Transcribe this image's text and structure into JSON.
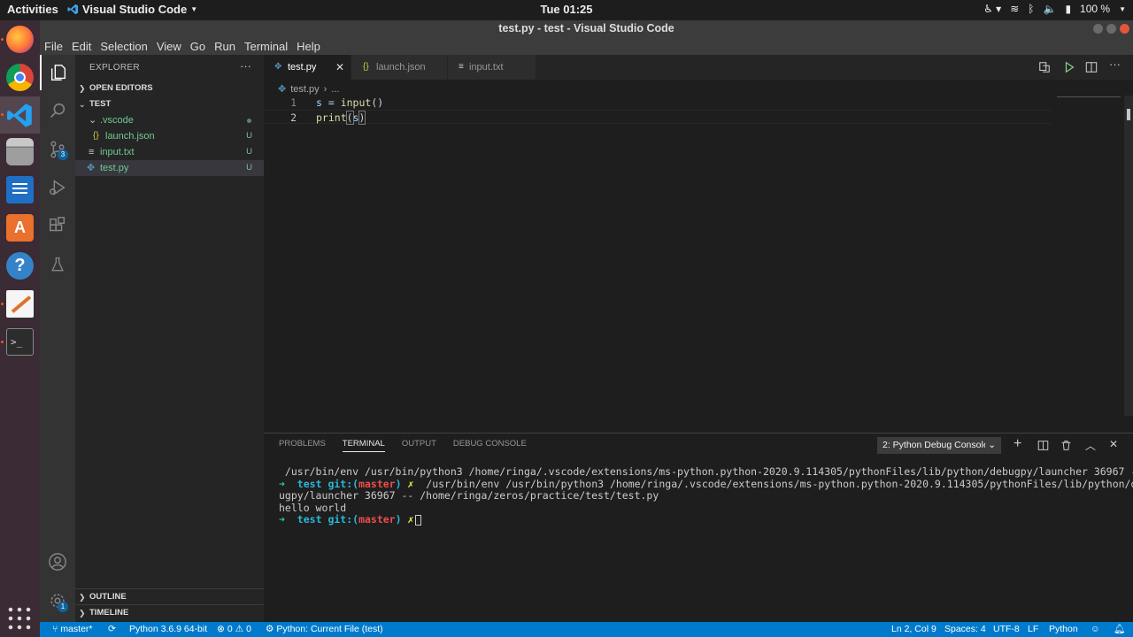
{
  "system": {
    "activities": "Activities",
    "app_name": "Visual Studio Code",
    "clock": "Tue 01:25",
    "battery": "100 %"
  },
  "window": {
    "title": "test.py - test - Visual Studio Code"
  },
  "menu": [
    "File",
    "Edit",
    "Selection",
    "View",
    "Go",
    "Run",
    "Terminal",
    "Help"
  ],
  "activity_bar": {
    "scm_badge": "3",
    "manage_badge": "1"
  },
  "explorer": {
    "header": "EXPLORER",
    "open_editors": "OPEN EDITORS",
    "folder": "TEST",
    "items": [
      {
        "label": ".vscode",
        "status": ""
      },
      {
        "label": "launch.json",
        "status": "U"
      },
      {
        "label": "input.txt",
        "status": "U"
      },
      {
        "label": "test.py",
        "status": "U"
      }
    ],
    "outline": "OUTLINE",
    "timeline": "TIMELINE"
  },
  "tabs": [
    {
      "label": "test.py",
      "icon": "python-icon"
    },
    {
      "label": "launch.json",
      "icon": "json-icon"
    },
    {
      "label": "input.txt",
      "icon": "text-file-icon"
    }
  ],
  "breadcrumb": {
    "file": "test.py",
    "rest": "..."
  },
  "code_lines": [
    {
      "num": "1",
      "a": "s = ",
      "fn": "input",
      "b": "()"
    },
    {
      "num": "2",
      "fn": "print",
      "open": "(",
      "arg": "s",
      "close": ")"
    }
  ],
  "panel": {
    "tabs": [
      "PROBLEMS",
      "TERMINAL",
      "OUTPUT",
      "DEBUG CONSOLE"
    ],
    "terminal_select": "2: Python Debug Console",
    "terminal": {
      "line1": " /usr/bin/env /usr/bin/python3 /home/ringa/.vscode/extensions/ms-python.python-2020.9.114305/pythonFiles/lib/python/debugpy/launcher 36967 --",
      "arrow": "➜",
      "dir": "test",
      "git": "git:(",
      "branch": "master",
      "git_close": ")",
      "x": "✗",
      "line2_cmd": "  /usr/bin/env /usr/bin/python3 /home/ringa/.vscode/extensions/ms-python.python-2020.9.114305/pythonFiles/lib/python/deb",
      "line3": "ugpy/launcher 36967 -- /home/ringa/zeros/practice/test/test.py",
      "output": "hello world"
    }
  },
  "status": {
    "branch": "master*",
    "python": "Python 3.6.9 64-bit",
    "errors": "0",
    "warnings": "0",
    "run_config": "Python: Current File (test)",
    "position": "Ln 2, Col 9",
    "spaces": "Spaces: 4",
    "encoding": "UTF-8",
    "eol": "LF",
    "language": "Python"
  },
  "colors": {
    "accent": "#007acc",
    "ubuntu_orange": "#e95420",
    "untracked": "#73c991"
  }
}
